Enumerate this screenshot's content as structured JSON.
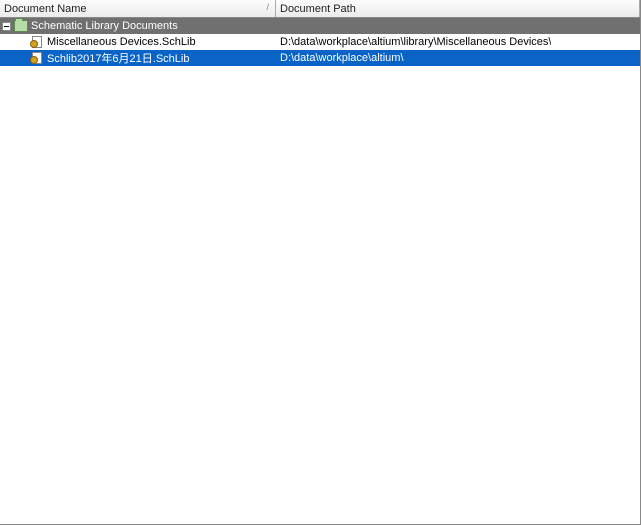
{
  "columns": {
    "name": "Document Name",
    "path": "Document Path",
    "sort_indicator": "/"
  },
  "group": {
    "label": "Schematic Library Documents",
    "expanded": true
  },
  "rows": [
    {
      "name": "Miscellaneous Devices.SchLib",
      "path": "D:\\data\\workplace\\altium\\library\\Miscellaneous Devices\\",
      "selected": false
    },
    {
      "name": "Schlib2017年6月21日.SchLib",
      "path": "D:\\data\\workplace\\altium\\",
      "selected": true
    }
  ]
}
